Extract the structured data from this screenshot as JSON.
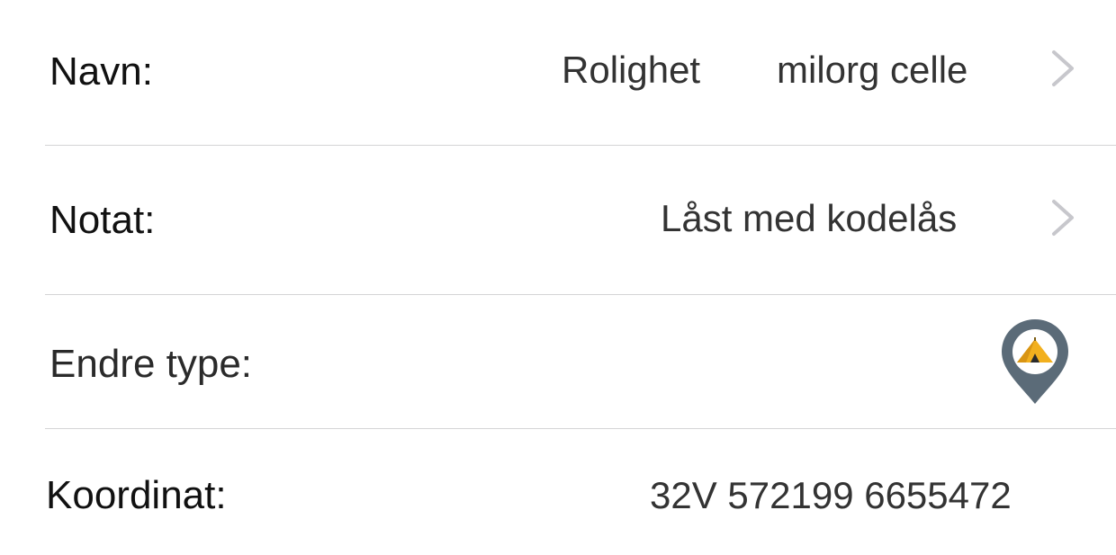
{
  "form": {
    "name": {
      "label": "Navn:",
      "value_first": "Rolighet",
      "value_second": "milorg celle"
    },
    "note": {
      "label": "Notat:",
      "value": "Låst med kodelås"
    },
    "type": {
      "label": "Endre type:",
      "icon": "tent-location-pin-icon"
    },
    "coordinate": {
      "label": "Koordinat:",
      "value": "32V 572199 6655472"
    }
  },
  "colors": {
    "label_text": "#111111",
    "value_text": "#333333",
    "chevron": "#c7c7cc",
    "divider": "#d4d4d6",
    "pin": "#5b6b78",
    "tent": "#f2b01e"
  }
}
